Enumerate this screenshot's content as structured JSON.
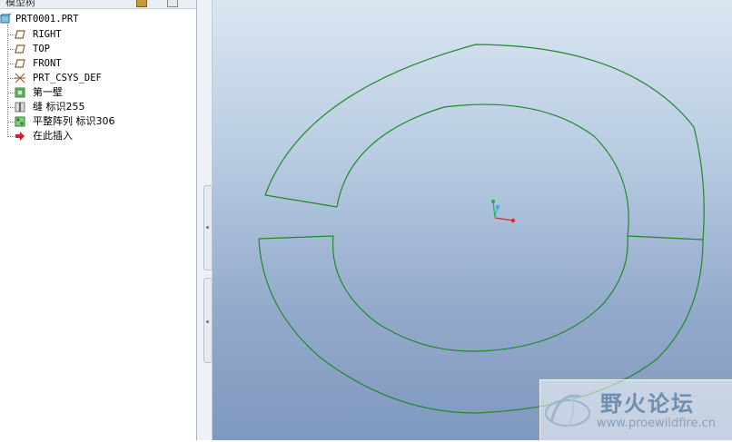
{
  "tree_panel": {
    "header_label": "模型树",
    "root": "PRT0001.PRT",
    "items": [
      {
        "label": "RIGHT",
        "icon": "datum-plane-icon"
      },
      {
        "label": "TOP",
        "icon": "datum-plane-icon"
      },
      {
        "label": "FRONT",
        "icon": "datum-plane-icon"
      },
      {
        "label": "PRT_CSYS_DEF",
        "icon": "coordinate-system-icon"
      },
      {
        "label": "第一壁",
        "icon": "sheetmetal-wall-icon"
      },
      {
        "label": "缝 标识255",
        "icon": "rip-feature-icon"
      },
      {
        "label": "平整阵列 标识306",
        "icon": "pattern-feature-icon"
      },
      {
        "label": "在此插入",
        "icon": "insert-here-arrow-icon"
      }
    ]
  },
  "watermark": {
    "title": "野火论坛",
    "url": "www.proewildfire.cn"
  },
  "colors": {
    "geometry": "#1f8a2a",
    "csys_x": "#d62b2b",
    "csys_y": "#2aa84a",
    "csys_z": "#2bb8d6"
  }
}
